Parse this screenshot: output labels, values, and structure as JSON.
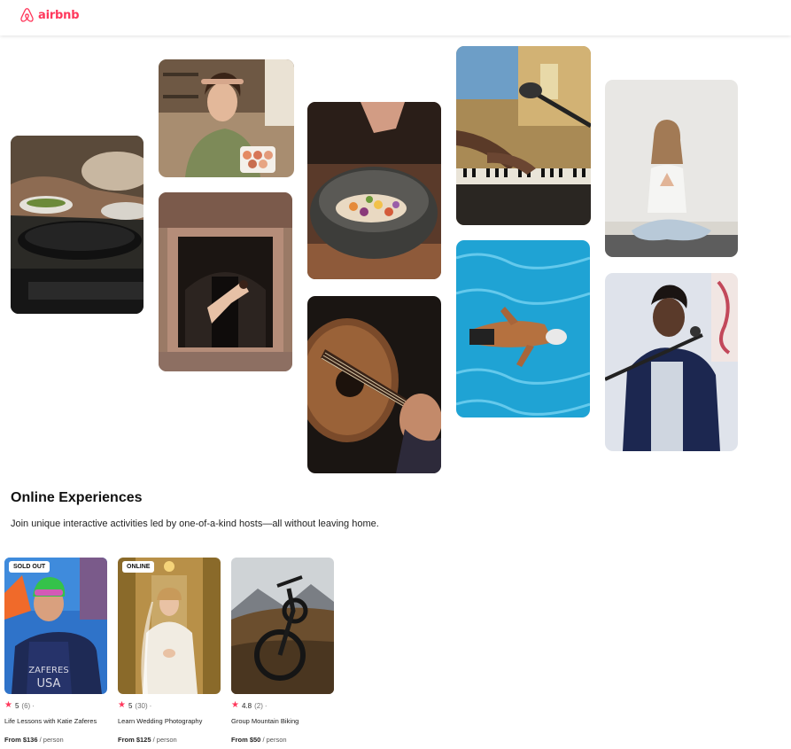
{
  "brand": {
    "name": "airbnb",
    "color": "#ff385c",
    "logo_icon": "airbnb-belo-icon"
  },
  "collage": [
    {
      "name": "photo-cooking-pans",
      "subject": "cooking"
    },
    {
      "name": "photo-woman-macarons",
      "subject": "baking"
    },
    {
      "name": "photo-dancer-doorway",
      "subject": "dance"
    },
    {
      "name": "photo-stone-bowl-food",
      "subject": "food"
    },
    {
      "name": "photo-acoustic-guitar",
      "subject": "guitar"
    },
    {
      "name": "photo-piano-microphone",
      "subject": "music"
    },
    {
      "name": "photo-swimmer-pool",
      "subject": "swimming"
    },
    {
      "name": "photo-yoga-woman",
      "subject": "yoga"
    },
    {
      "name": "photo-singer-microphone",
      "subject": "singing"
    }
  ],
  "section": {
    "title": "Online Experiences",
    "subtitle": "Join unique interactive activities led by one-of-a-kind hosts—all without leaving home."
  },
  "cards": [
    {
      "badge": "SOLD OUT",
      "rating": "5",
      "reviews": "(6)",
      "separator": "·",
      "title": "Life Lessons with Katie Zaferes",
      "price_label": "From $136",
      "price_unit": "/ person"
    },
    {
      "badge": "ONLINE",
      "rating": "5",
      "reviews": "(30)",
      "separator": "·",
      "title": "Learn Wedding Photography",
      "price_label": "From $125",
      "price_unit": "/ person"
    },
    {
      "badge": "",
      "rating": "4.8",
      "reviews": "(2)",
      "separator": "·",
      "title": "Group Mountain Biking",
      "price_label": "From $50",
      "price_unit": "/ person"
    }
  ],
  "colors": {
    "accent": "#ff385c",
    "text": "#222222",
    "muted": "#717171"
  }
}
